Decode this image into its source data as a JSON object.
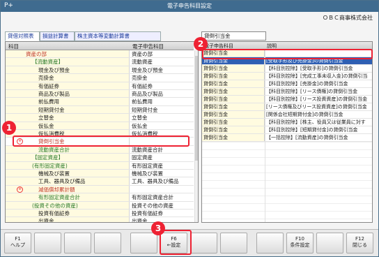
{
  "window": {
    "title": "電子申告科目設定",
    "company": "ＯＢＣ商事株式会社",
    "app_icon": "plus-icon"
  },
  "tabs": [
    {
      "label": "貸借対照表",
      "active": true
    },
    {
      "label": "損益計算書",
      "active": false
    },
    {
      "label": "株主資本等変動計算書",
      "active": false
    }
  ],
  "left_grid": {
    "headers": [
      "科目",
      "電子申告科目"
    ],
    "rows": [
      {
        "name": "資産の部",
        "value": "資産の部",
        "indent": 2,
        "color": "#c0392b",
        "badge": ""
      },
      {
        "name": "【流動資産】",
        "value": "流動資産",
        "indent": 3,
        "color": "#2a7a2a",
        "badge": ""
      },
      {
        "name": "現金及び預金",
        "value": "現金及び預金",
        "indent": 4,
        "color": "#222",
        "badge": ""
      },
      {
        "name": "売掛金",
        "value": "売掛金",
        "indent": 4,
        "color": "#222",
        "badge": ""
      },
      {
        "name": "有価証券",
        "value": "有価証券",
        "indent": 4,
        "color": "#222",
        "badge": ""
      },
      {
        "name": "商品及び製品",
        "value": "商品及び製品",
        "indent": 4,
        "color": "#222",
        "badge": ""
      },
      {
        "name": "前払費用",
        "value": "前払費用",
        "indent": 4,
        "color": "#222",
        "badge": ""
      },
      {
        "name": "短期貸付金",
        "value": "短期貸付金",
        "indent": 4,
        "color": "#222",
        "badge": ""
      },
      {
        "name": "立替金",
        "value": "立替金",
        "indent": 4,
        "color": "#222",
        "badge": ""
      },
      {
        "name": "仮払金",
        "value": "仮払金",
        "indent": 4,
        "color": "#222",
        "badge": ""
      },
      {
        "name": "仮払消費税",
        "value": "仮払消費税",
        "indent": 4,
        "color": "#222",
        "badge": ""
      },
      {
        "name": "貸倒引当金",
        "value": "",
        "indent": 4,
        "color": "#c0392b",
        "badge": "※",
        "selected": true
      },
      {
        "name": "流動資産合計",
        "value": "流動資産合計",
        "indent": 4,
        "color": "#2a7a2a",
        "badge": ""
      },
      {
        "name": "【固定資産】",
        "value": "固定資産",
        "indent": 3,
        "color": "#2a7a2a",
        "badge": ""
      },
      {
        "name": "(有形固定資産)",
        "value": "有形固定資産",
        "indent": 3,
        "color": "#2a7a2a",
        "badge": ""
      },
      {
        "name": "機械及び装置",
        "value": "機械及び装置",
        "indent": 4,
        "color": "#222",
        "badge": ""
      },
      {
        "name": "工具、器具及び備品",
        "value": "工具、器具及び備品",
        "indent": 4,
        "color": "#222",
        "badge": ""
      },
      {
        "name": "減価償却累計額",
        "value": "",
        "indent": 4,
        "color": "#c0392b",
        "badge": "※"
      },
      {
        "name": "有形固定資産合計",
        "value": "有形固定資産合計",
        "indent": 4,
        "color": "#2a7a2a",
        "badge": ""
      },
      {
        "name": "(投資その他の資産)",
        "value": "投資その他の資産",
        "indent": 3,
        "color": "#2a7a2a",
        "badge": ""
      },
      {
        "name": "投資有価証券",
        "value": "投資有価証券",
        "indent": 4,
        "color": "#222",
        "badge": ""
      },
      {
        "name": "出資金",
        "value": "出資金",
        "indent": 4,
        "color": "#222",
        "badge": ""
      }
    ]
  },
  "search": {
    "value": "貸倒引当金"
  },
  "right_grid": {
    "headers": [
      "電子申告科目",
      "説明"
    ],
    "rows": [
      {
        "name": "貸倒引当金",
        "desc": "",
        "selected": false
      },
      {
        "name": "貸倒引当金",
        "desc": "[受取手形及び売掛金]の貸倒引当金",
        "selected": true
      },
      {
        "name": "貸倒引当金",
        "desc": "【科目別控除】[受取手形]の貸倒引当金"
      },
      {
        "name": "貸倒引当金",
        "desc": "【科目別控除】[完成工事未収入金]の貸倒引当"
      },
      {
        "name": "貸倒引当金",
        "desc": "【科目別控除】[売掛金]の貸倒引当金"
      },
      {
        "name": "貸倒引当金",
        "desc": "【科目別控除】[リース債権]の貸倒引当金"
      },
      {
        "name": "貸倒引当金",
        "desc": "【科目別控除】[リース投資資産]の貸倒引当金"
      },
      {
        "name": "貸倒引当金",
        "desc": "[リース債権及びリース投資資産]の貸倒引当金"
      },
      {
        "name": "貸倒引当金",
        "desc": "[関係会社短期貸付金]の貸倒引当金"
      },
      {
        "name": "貸倒引当金",
        "desc": "【科目別控除】[株主、役員又は従業員に対す"
      },
      {
        "name": "貸倒引当金",
        "desc": "【科目別控除】[短期貸付金]の貸倒引当金"
      },
      {
        "name": "貸倒引当金",
        "desc": "【一括控除】[流動資産]の貸倒引当金"
      }
    ]
  },
  "function_keys": [
    {
      "key": "F1",
      "label": "ヘルプ"
    },
    {
      "key": "",
      "label": ""
    },
    {
      "key": "",
      "label": ""
    },
    {
      "key": "",
      "label": ""
    },
    {
      "key": "",
      "label": ""
    },
    {
      "key": "F6",
      "label": "←設定"
    },
    {
      "key": "",
      "label": ""
    },
    {
      "key": "",
      "label": ""
    },
    {
      "key": "",
      "label": ""
    },
    {
      "key": "F10",
      "label": "条件設定"
    },
    {
      "key": "",
      "label": ""
    },
    {
      "key": "F12",
      "label": "閉じる"
    }
  ],
  "callouts": [
    "1",
    "2",
    "3"
  ],
  "colors": {
    "titlebar": "#3f6b8f",
    "highlight": "#e23",
    "selection": "#2f5fb3"
  }
}
